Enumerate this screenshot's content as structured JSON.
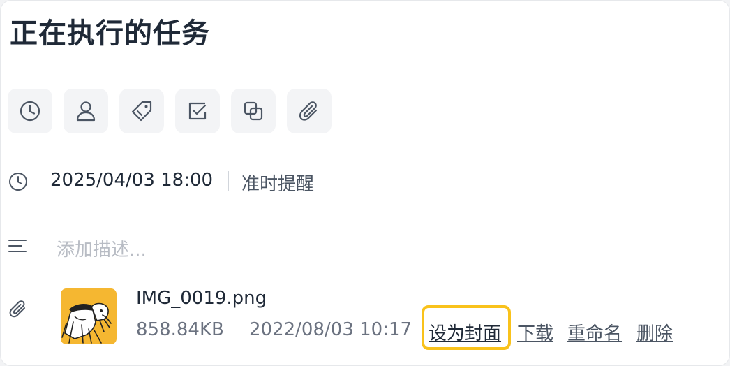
{
  "task": {
    "title": "正在执行的任务"
  },
  "toolbar": {
    "buttons": [
      {
        "icon": "clock-icon"
      },
      {
        "icon": "user-icon"
      },
      {
        "icon": "tag-icon"
      },
      {
        "icon": "checkbox-icon"
      },
      {
        "icon": "subtask-icon"
      },
      {
        "icon": "paperclip-icon"
      }
    ]
  },
  "due": {
    "icon": "clock-icon",
    "datetime": "2025/04/03 18:00",
    "reminder": "准时提醒"
  },
  "description": {
    "icon": "text-lines-icon",
    "placeholder": "添加描述..."
  },
  "attachment": {
    "icon": "paperclip-icon",
    "file_name": "IMG_0019.png",
    "file_size": "858.84KB",
    "uploaded_at": "2022/08/03 10:17",
    "actions": {
      "set_cover": "设为封面",
      "download": "下载",
      "rename": "重命名",
      "delete": "删除"
    }
  },
  "colors": {
    "highlight": "#f9c21b",
    "thumbnail_bg": "#f5b731",
    "text_primary": "#1f2937",
    "text_secondary": "#6b7280",
    "placeholder": "#b8bcc4"
  }
}
